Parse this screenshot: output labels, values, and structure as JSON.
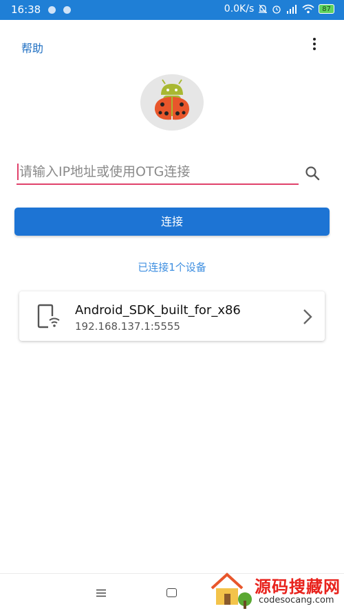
{
  "status_bar": {
    "time": "16:38",
    "network_speed": "0.0K/s",
    "battery": "87"
  },
  "header": {
    "help_label": "帮助"
  },
  "search": {
    "placeholder": "请输入IP地址或使用OTG连接"
  },
  "connect_button": {
    "label": "连接"
  },
  "connected_count": "已连接1个设备",
  "devices": [
    {
      "name": "Android_SDK_built_for_x86",
      "address": "192.168.137.1:5555"
    }
  ],
  "watermark": {
    "title": "源码搜藏网",
    "domain": "codesocang.com"
  },
  "colors": {
    "primary": "#1d74d4",
    "accent": "#e0406a",
    "status_bar": "#1f7fd6"
  }
}
